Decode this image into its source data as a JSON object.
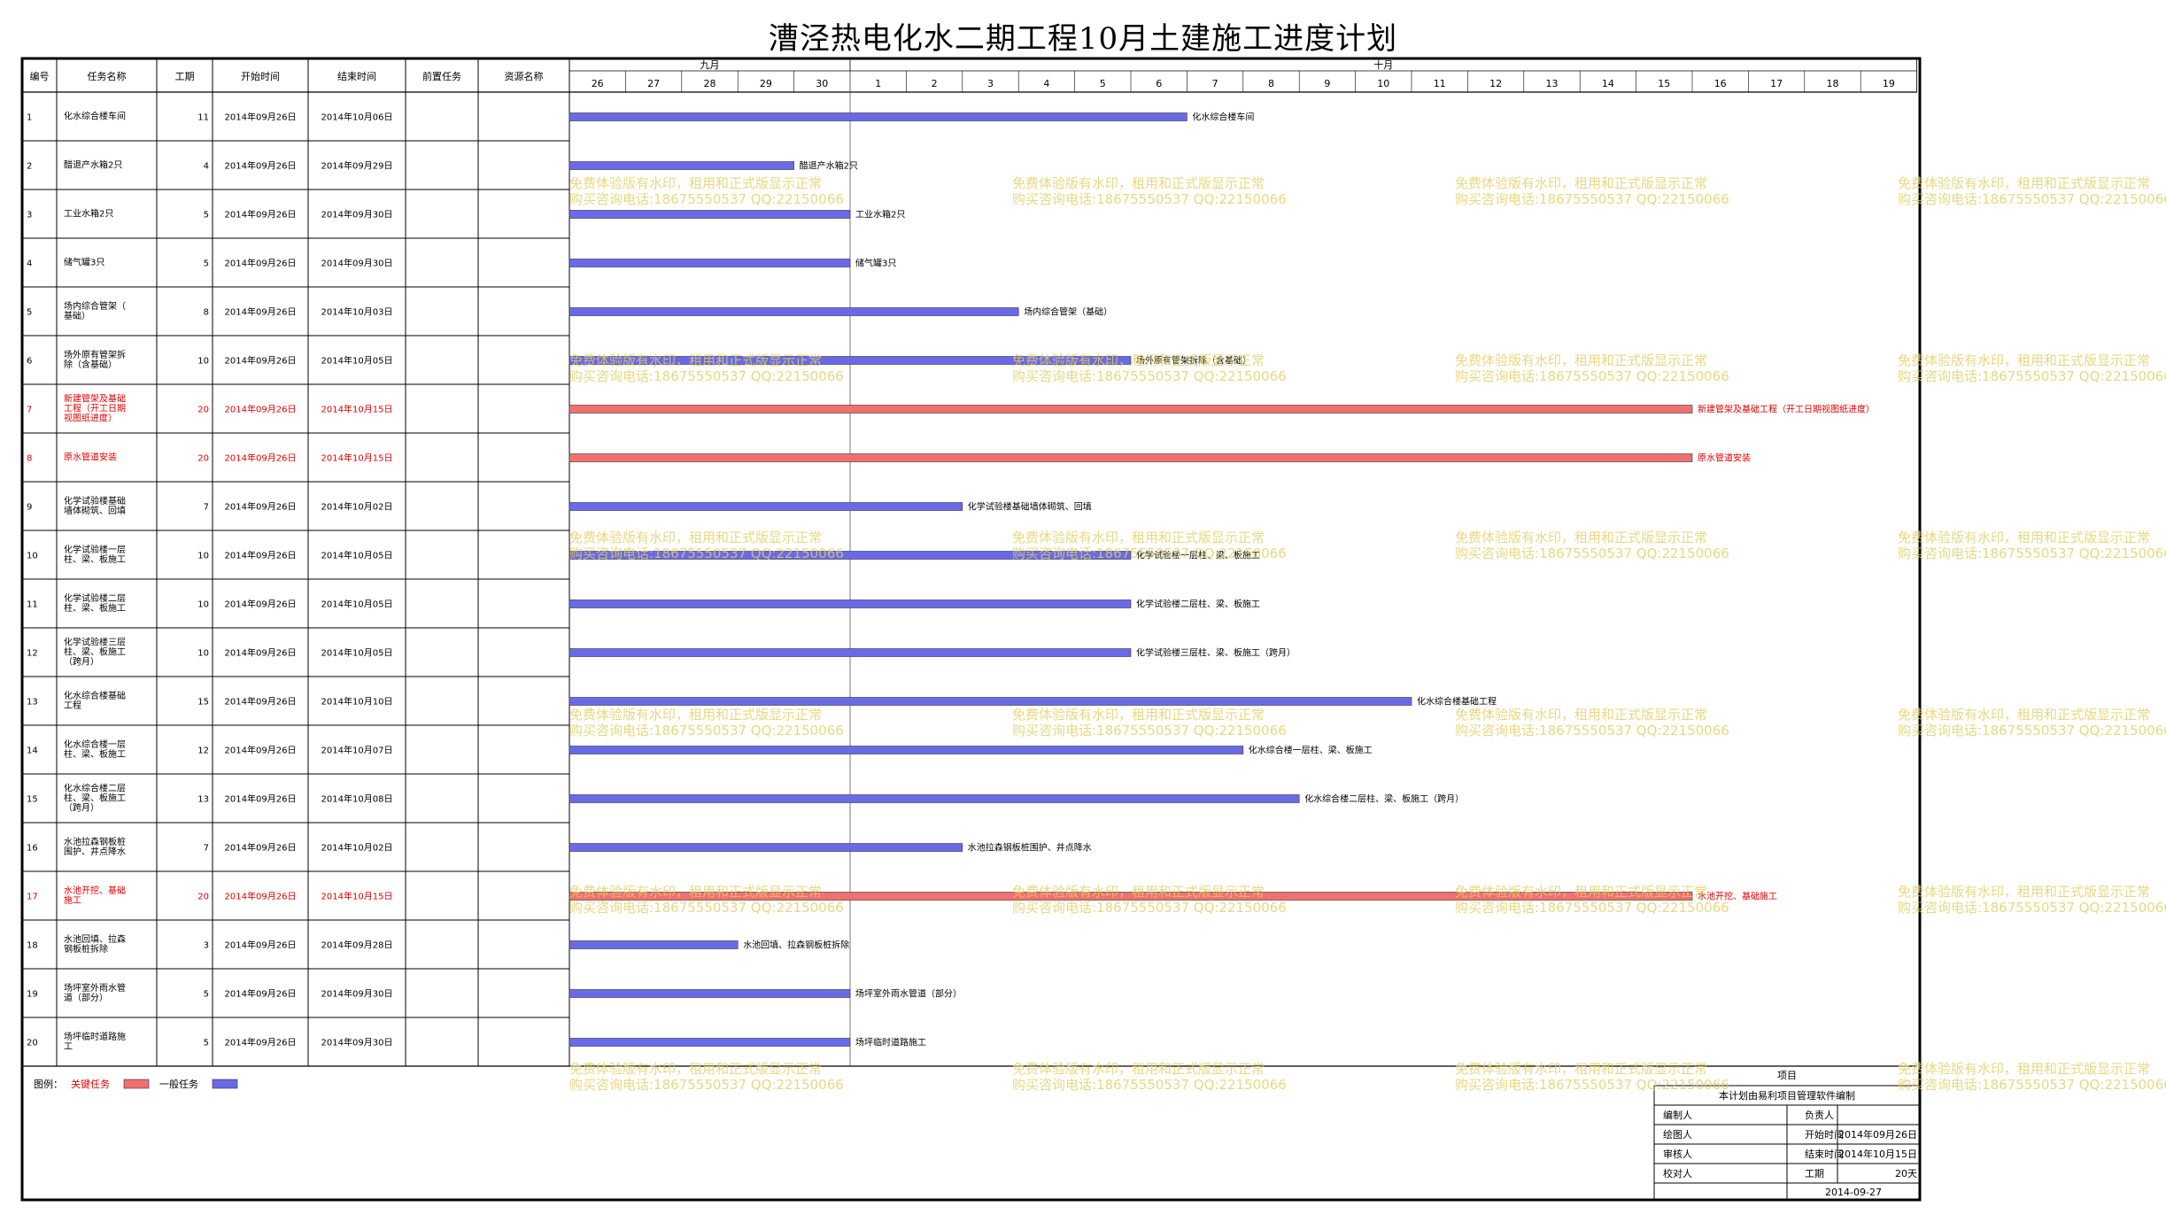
{
  "title": "漕泾热电化水二期工程10月土建施工进度计划",
  "headers": [
    "编号",
    "任务名称",
    "工期",
    "开始时间",
    "结束时间",
    "前置任务",
    "资源名称"
  ],
  "months": [
    {
      "label": "九月",
      "first_day": "26"
    },
    {
      "label": "十月",
      "first_day": "1"
    }
  ],
  "days": [
    "26",
    "27",
    "28",
    "29",
    "30",
    "1",
    "2",
    "3",
    "4",
    "5",
    "6",
    "7",
    "8",
    "9",
    "10",
    "11",
    "12",
    "13",
    "14",
    "15",
    "16",
    "17",
    "18",
    "19"
  ],
  "colors": {
    "critical": "#f07070",
    "general": "#6a6ae8",
    "critical_text": "#e00000",
    "watermark": "#e2cf63"
  },
  "chart_data": {
    "type": "gantt",
    "title": "漕泾热电化水二期工程10月土建施工进度计划",
    "tasks": [
      {
        "id": "1",
        "name": "化水综合楼车间",
        "duration": "11",
        "start": "2014年09月26日",
        "end": "2014年10月06日",
        "bar_label": "化水综合楼车间",
        "critical": false
      },
      {
        "id": "2",
        "name": "醋退产水箱2只",
        "duration": "4",
        "start": "2014年09月26日",
        "end": "2014年09月29日",
        "bar_label": "醋退产水箱2只",
        "critical": false
      },
      {
        "id": "3",
        "name": "工业水箱2只",
        "duration": "5",
        "start": "2014年09月26日",
        "end": "2014年09月30日",
        "bar_label": "工业水箱2只",
        "critical": false
      },
      {
        "id": "4",
        "name": "储气罐3只",
        "duration": "5",
        "start": "2014年09月26日",
        "end": "2014年09月30日",
        "bar_label": "储气罐3只",
        "critical": false
      },
      {
        "id": "5",
        "name": "场内综合管架（基础）",
        "duration": "8",
        "start": "2014年09月26日",
        "end": "2014年10月03日",
        "bar_label": "场内综合管架（基础）",
        "critical": false
      },
      {
        "id": "6",
        "name": "场外原有管架拆除（含基础）",
        "duration": "10",
        "start": "2014年09月26日",
        "end": "2014年10月05日",
        "bar_label": "场外原有管架拆除（含基础）",
        "critical": false
      },
      {
        "id": "7",
        "name": "新建管架及基础工程（开工日期视图纸进度）",
        "duration": "20",
        "start": "2014年09月26日",
        "end": "2014年10月15日",
        "bar_label": "新建管架及基础工程（开工日期视图纸进度）",
        "critical": true
      },
      {
        "id": "8",
        "name": "原水管道安装",
        "duration": "20",
        "start": "2014年09月26日",
        "end": "2014年10月15日",
        "bar_label": "原水管道安装",
        "critical": true
      },
      {
        "id": "9",
        "name": "化学试验楼基础墙体砌筑、回填",
        "duration": "7",
        "start": "2014年09月26日",
        "end": "2014年10月02日",
        "bar_label": "化学试验楼基础墙体砌筑、回填",
        "critical": false
      },
      {
        "id": "10",
        "name": "化学试验楼一层柱、梁、板施工",
        "duration": "10",
        "start": "2014年09月26日",
        "end": "2014年10月05日",
        "bar_label": "化学试验楼一层柱、梁、板施工",
        "critical": false
      },
      {
        "id": "11",
        "name": "化学试验楼二层柱、梁、板施工",
        "duration": "10",
        "start": "2014年09月26日",
        "end": "2014年10月05日",
        "bar_label": "化学试验楼二层柱、梁、板施工",
        "critical": false
      },
      {
        "id": "12",
        "name": "化学试验楼三层柱、梁、板施工（跨月）",
        "duration": "10",
        "start": "2014年09月26日",
        "end": "2014年10月05日",
        "bar_label": "化学试验楼三层柱、梁、板施工（跨月）",
        "critical": false
      },
      {
        "id": "13",
        "name": "化水综合楼基础工程",
        "duration": "15",
        "start": "2014年09月26日",
        "end": "2014年10月10日",
        "bar_label": "化水综合楼基础工程",
        "critical": false
      },
      {
        "id": "14",
        "name": "化水综合楼一层柱、梁、板施工",
        "duration": "12",
        "start": "2014年09月26日",
        "end": "2014年10月07日",
        "bar_label": "化水综合楼一层柱、梁、板施工",
        "critical": false
      },
      {
        "id": "15",
        "name": "化水综合楼二层柱、梁、板施工（跨月）",
        "duration": "13",
        "start": "2014年09月26日",
        "end": "2014年10月08日",
        "bar_label": "化水综合楼二层柱、梁、板施工（跨月）",
        "critical": false
      },
      {
        "id": "16",
        "name": "水池拉森钢板桩围护、井点降水",
        "duration": "7",
        "start": "2014年09月26日",
        "end": "2014年10月02日",
        "bar_label": "水池拉森钢板桩围护、井点降水",
        "critical": false
      },
      {
        "id": "17",
        "name": "水池开挖、基础施工",
        "duration": "20",
        "start": "2014年09月26日",
        "end": "2014年10月15日",
        "bar_label": "水池开挖、基础施工",
        "critical": true
      },
      {
        "id": "18",
        "name": "水池回填、拉森钢板桩拆除",
        "duration": "3",
        "start": "2014年09月26日",
        "end": "2014年09月28日",
        "bar_label": "水池回填、拉森钢板桩拆除",
        "critical": false
      },
      {
        "id": "19",
        "name": "场坪室外雨水管道（部分）",
        "duration": "5",
        "start": "2014年09月26日",
        "end": "2014年09月30日",
        "bar_label": "场坪室外雨水管道（部分）",
        "critical": false
      },
      {
        "id": "20",
        "name": "场坪临时道路施工",
        "duration": "5",
        "start": "2014年09月26日",
        "end": "2014年09月30日",
        "bar_label": "场坪临时道路施工",
        "critical": false
      }
    ]
  },
  "legend": {
    "label": "图例：",
    "critical": "关键任务",
    "general": "一般任务"
  },
  "info": {
    "project_label": "项目",
    "software_note": "本计划由易利项目管理软件编制",
    "rows": [
      {
        "left": "编制人",
        "mid": "负责人",
        "right": ""
      },
      {
        "left": "绘图人",
        "mid": "开始时间",
        "right": "2014年09月26日"
      },
      {
        "left": "审核人",
        "mid": "结束时间",
        "right": "2014年10月15日"
      },
      {
        "left": "校对人",
        "mid": "工期",
        "right": "20天"
      }
    ],
    "date": "2014-09-27"
  },
  "watermark": {
    "line1": "免费体验版有水印，租用和正式版显示正常",
    "line2": "购买咨询电话:18675550537 QQ:22150066"
  }
}
